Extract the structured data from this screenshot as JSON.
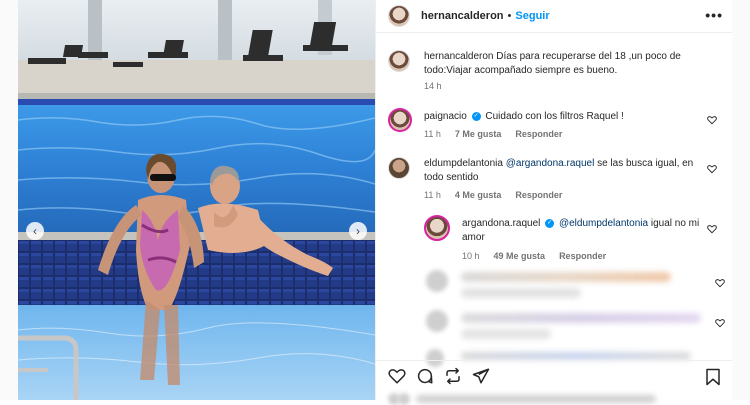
{
  "post": {
    "username": "hernancalderon",
    "follow_label": "Seguir",
    "separator": "•",
    "more_label": "•••",
    "caption": "Días para recuperarse del 18 ,un poco de todo:Viajar acompañado siempre es bueno.",
    "caption_time": "14 h"
  },
  "comments": [
    {
      "user": "paignacio",
      "verified": true,
      "text": "Cuidado con los filtros Raquel !",
      "time": "11 h",
      "likes": "7 Me gusta",
      "reply": "Responder"
    },
    {
      "user": "eldumpdelantonia",
      "verified": false,
      "mention": "@argandona.raquel",
      "text": " se las busca igual, en todo sentido",
      "time": "11 h",
      "likes": "4 Me gusta",
      "reply": "Responder"
    },
    {
      "user": "argandona.raquel",
      "verified": true,
      "mention": "@eldumpdelantonia",
      "text": " igual no mi amor",
      "time": "10 h",
      "likes": "49 Me gusta",
      "reply": "Responder"
    }
  ],
  "photo": {
    "prev_icon": "‹",
    "next_icon": "›"
  },
  "colors": {
    "link": "#0095f6",
    "mention": "#00376b",
    "muted": "#737373",
    "water": "#3b8fe0"
  },
  "icons": [
    "heart-icon",
    "comment-icon",
    "repost-icon",
    "share-icon",
    "bookmark-icon",
    "more-icon",
    "verified-icon"
  ]
}
